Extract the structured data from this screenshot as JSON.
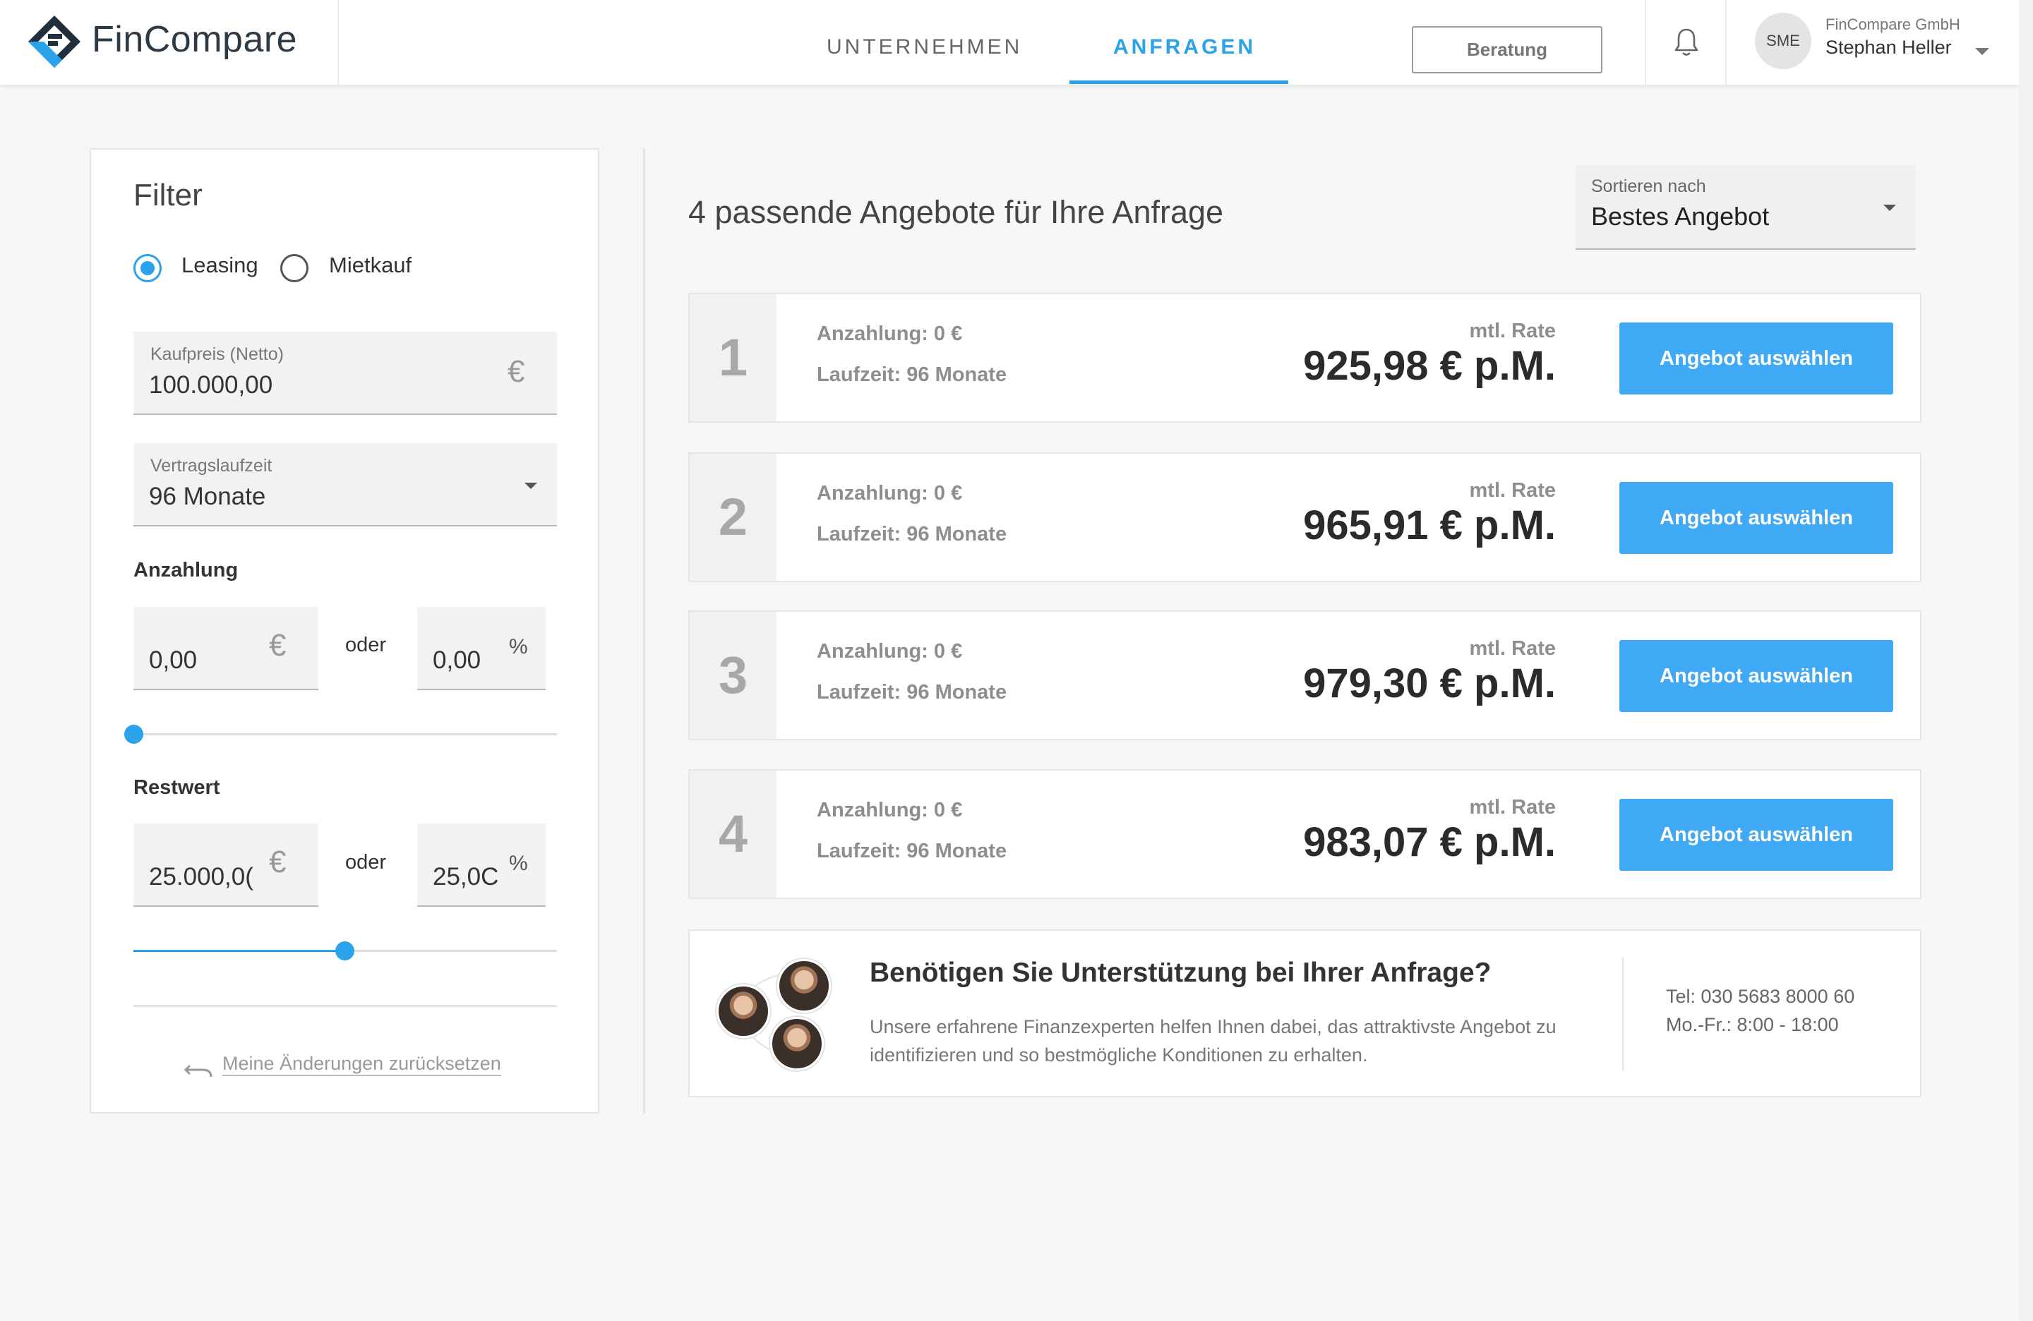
{
  "brand": {
    "name": "FinCompare",
    "accent": "#2aa3ea",
    "button_blue": "#3fa9f5"
  },
  "nav": {
    "tabs": [
      {
        "label": "UNTERNEHMEN",
        "active": false
      },
      {
        "label": "ANFRAGEN",
        "active": true
      }
    ]
  },
  "header": {
    "beratung_label": "Beratung",
    "bell_icon": "bell-icon"
  },
  "user": {
    "initials": "SME",
    "company": "FinCompare GmbH",
    "name": "Stephan Heller"
  },
  "filter": {
    "title": "Filter",
    "options": [
      {
        "label": "Leasing",
        "selected": true
      },
      {
        "label": "Mietkauf",
        "selected": false
      }
    ],
    "kaufpreis": {
      "label": "Kaufpreis (Netto)",
      "value": "100.000,00",
      "currency": "€"
    },
    "laufzeit": {
      "label": "Vertragslaufzeit",
      "value": "96 Monate"
    },
    "anzahlung": {
      "label": "Anzahlung",
      "amount": "0,00",
      "currency": "€",
      "oder": "oder",
      "percent": "0,00",
      "percent_sign": "%",
      "slider_fraction": 0.0
    },
    "restwert": {
      "label": "Restwert",
      "amount": "25.000,0(",
      "currency": "€",
      "oder": "oder",
      "percent": "25,0C",
      "percent_sign": "%",
      "slider_fraction": 0.5
    },
    "reset_label": "Meine Änderungen zurücksetzen"
  },
  "results": {
    "title": "4 passende Angebote für Ihre Anfrage",
    "sort": {
      "label": "Sortieren nach",
      "value": "Bestes Angebot"
    },
    "offers": [
      {
        "rank": "1",
        "anzahlung": "Anzahlung: 0 €",
        "laufzeit": "Laufzeit: 96 Monate",
        "rate_label": "mtl. Rate",
        "rate": "925,98 € p.M.",
        "button": "Angebot auswählen"
      },
      {
        "rank": "2",
        "anzahlung": "Anzahlung: 0 €",
        "laufzeit": "Laufzeit: 96 Monate",
        "rate_label": "mtl. Rate",
        "rate": "965,91 € p.M.",
        "button": "Angebot auswählen"
      },
      {
        "rank": "3",
        "anzahlung": "Anzahlung: 0 €",
        "laufzeit": "Laufzeit: 96 Monate",
        "rate_label": "mtl. Rate",
        "rate": "979,30 € p.M.",
        "button": "Angebot auswählen"
      },
      {
        "rank": "4",
        "anzahlung": "Anzahlung: 0 €",
        "laufzeit": "Laufzeit: 96 Monate",
        "rate_label": "mtl. Rate",
        "rate": "983,07 € p.M.",
        "button": "Angebot auswählen"
      }
    ]
  },
  "support": {
    "title": "Benötigen Sie Unterstützung bei Ihrer Anfrage?",
    "text": "Unsere erfahrene Finanzexperten helfen Ihnen dabei, das attraktivste Angebot zu identifizieren und so bestmögliche Konditionen zu erhalten.",
    "tel": "Tel: 030 5683 8000 60",
    "hours": "Mo.-Fr.: 8:00 - 18:00"
  }
}
